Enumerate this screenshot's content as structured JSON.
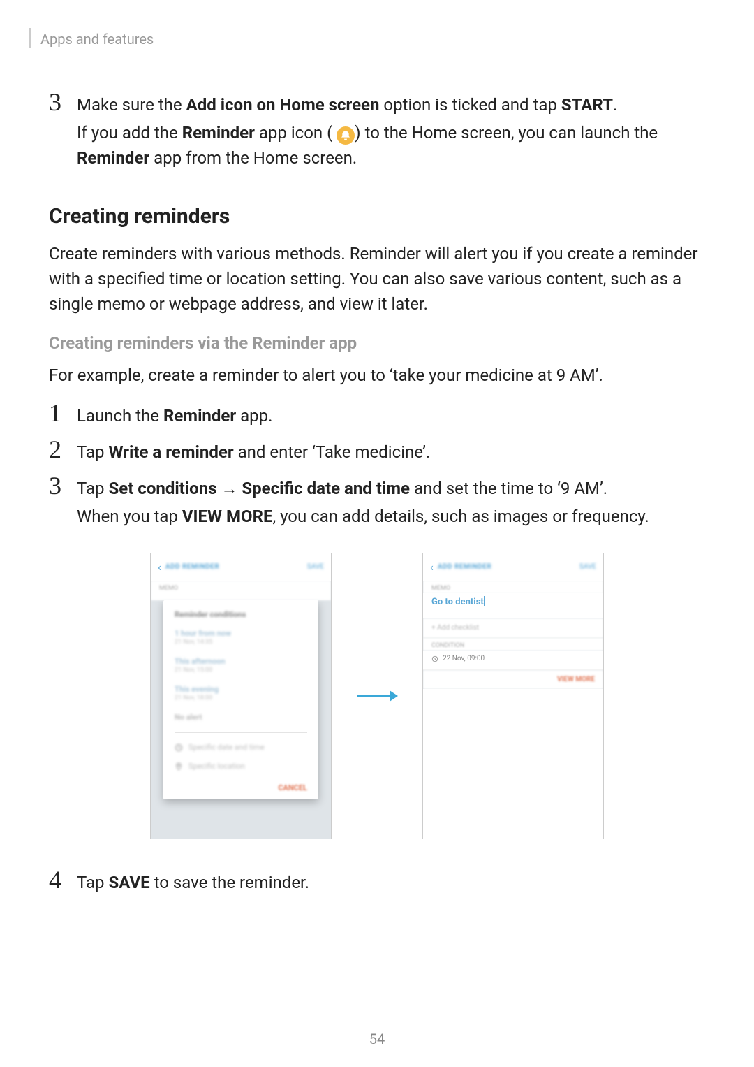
{
  "running_head": "Apps and features",
  "page_number": "54",
  "step3_top": {
    "num": "3",
    "line1_pre": "Make sure the ",
    "line1_bold": "Add icon on Home screen",
    "line1_mid": " option is ticked and tap ",
    "line1_bold2": "START",
    "line1_end": ".",
    "line2_pre": "If you add the ",
    "line2_bold": "Reminder",
    "line2_mid": " app icon (",
    "line2_post": ") to the Home screen, you can launch the ",
    "line3_bold": "Reminder",
    "line3_post": " app from the Home screen."
  },
  "h2": "Creating reminders",
  "intro": "Create reminders with various methods. Reminder will alert you if you create a reminder with a specified time or location setting. You can also save various content, such as a single memo or webpage address, and view it later.",
  "h3": "Creating reminders via the Reminder app",
  "example": "For example, create a reminder to alert you to ‘take your medicine at 9 AM’.",
  "list": {
    "s1": {
      "num": "1",
      "pre": "Launch the ",
      "bold": "Reminder",
      "post": " app."
    },
    "s2": {
      "num": "2",
      "pre": "Tap ",
      "bold": "Write a reminder",
      "post": " and enter ‘Take medicine’."
    },
    "s3": {
      "num": "3",
      "l1_pre": "Tap ",
      "l1_b1": "Set conditions",
      "l1_arrow": " → ",
      "l1_b2": "Specific date and time",
      "l1_post": " and set the time to ‘9 AM’.",
      "l2_pre": "When you tap ",
      "l2_b": "VIEW MORE",
      "l2_post": ", you can add details, such as images or frequency."
    },
    "s4": {
      "num": "4",
      "pre": "Tap ",
      "bold": "SAVE",
      "post": " to save the reminder."
    }
  },
  "fig": {
    "left": {
      "title": "ADD REMINDER",
      "save": "SAVE",
      "memo": "MEMO",
      "popup_title": "Reminder conditions",
      "opt1": "1 hour from now",
      "opt1_sub": "21 Nov, 14:35",
      "opt2": "This afternoon",
      "opt2_sub": "21 Nov, 15:00",
      "opt3": "This evening",
      "opt3_sub": "21 Nov, 18:00",
      "opt4": "No alert",
      "opt5": "Specific date and time",
      "opt6": "Specific location",
      "cancel": "CANCEL"
    },
    "right": {
      "title": "ADD REMINDER",
      "save": "SAVE",
      "memo": "MEMO",
      "memo_text": "Go to dentist",
      "add_checklist": "+  Add checklist",
      "condition_label": "CONDITION",
      "condition_value": "22 Nov, 09:00",
      "view_more": "VIEW MORE"
    }
  }
}
